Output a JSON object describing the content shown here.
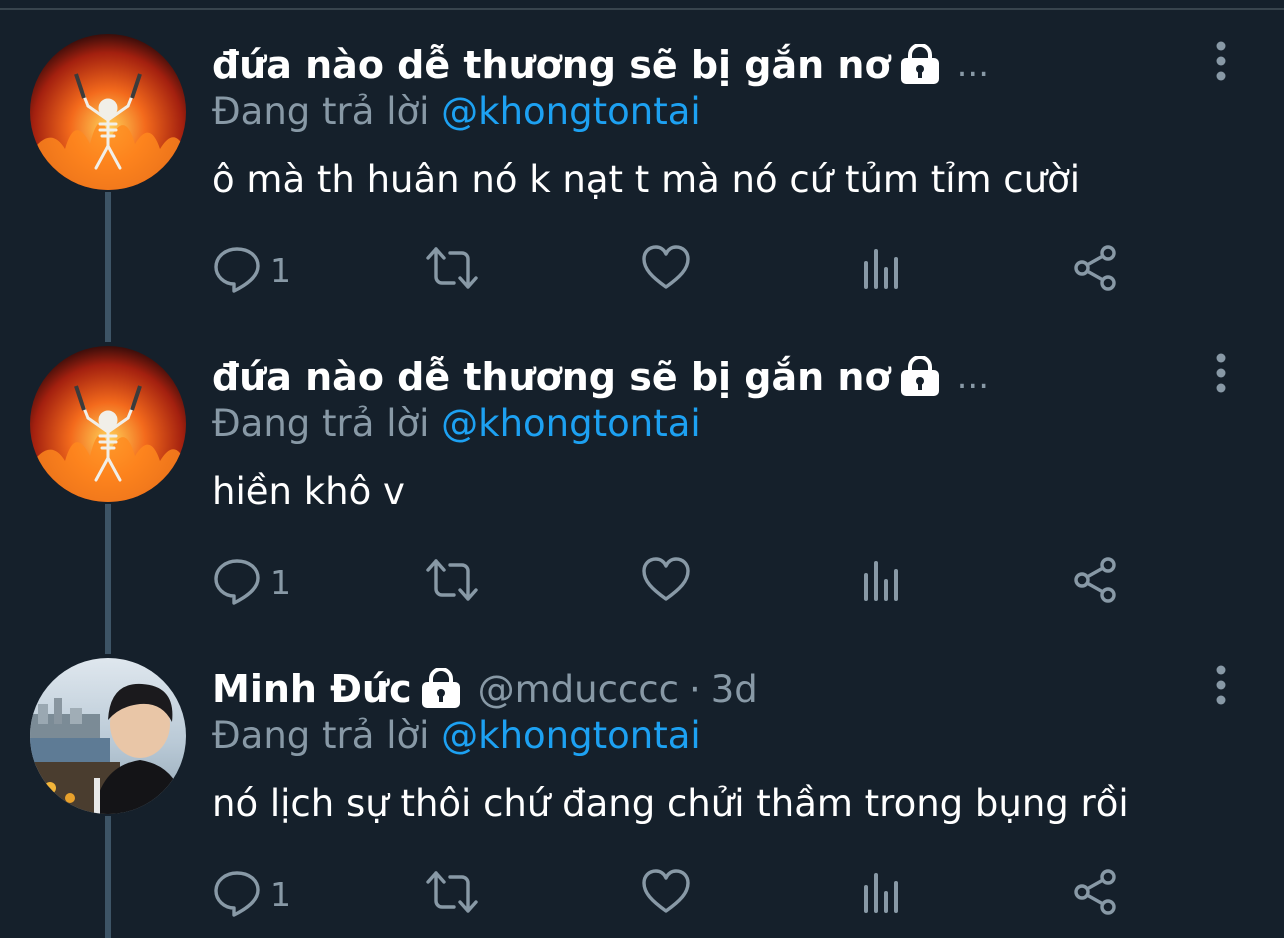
{
  "tweets": [
    {
      "display_name": "đứa nào dễ thương sẽ bị gắn nơ",
      "handle": "",
      "time": "",
      "overflow": "...",
      "reply_prefix": "Đang trả lời",
      "reply_mention": "@khongtontai",
      "text": "ô mà th huân nó k nạt t mà nó cứ tủm tỉm cười",
      "reply_count": "1",
      "avatar": "fire-skeleton"
    },
    {
      "display_name": "đứa nào dễ thương sẽ bị gắn nơ",
      "handle": "",
      "time": "",
      "overflow": "...",
      "reply_prefix": "Đang trả lời",
      "reply_mention": "@khongtontai",
      "text": "hiền khô v",
      "reply_count": "1",
      "avatar": "fire-skeleton"
    },
    {
      "display_name": "Minh Đức",
      "handle": "@mducccc",
      "separator": "·",
      "time": "3d",
      "reply_prefix": "Đang trả lời",
      "reply_mention": "@khongtontai",
      "text": "nó lịch sự thôi chứ đang chửi thầm trong bụng rồi",
      "reply_count": "1",
      "avatar": "person-photo"
    }
  ],
  "icons": {
    "lock": "lock-icon",
    "reply": "reply-icon",
    "retweet": "retweet-icon",
    "like": "heart-icon",
    "analytics": "analytics-icon",
    "share": "share-icon",
    "more": "more-vertical-icon"
  },
  "colors": {
    "background": "#15202b",
    "text": "#ffffff",
    "secondary": "#8899a6",
    "link": "#1da1f2",
    "thread_line": "#3d5466"
  }
}
